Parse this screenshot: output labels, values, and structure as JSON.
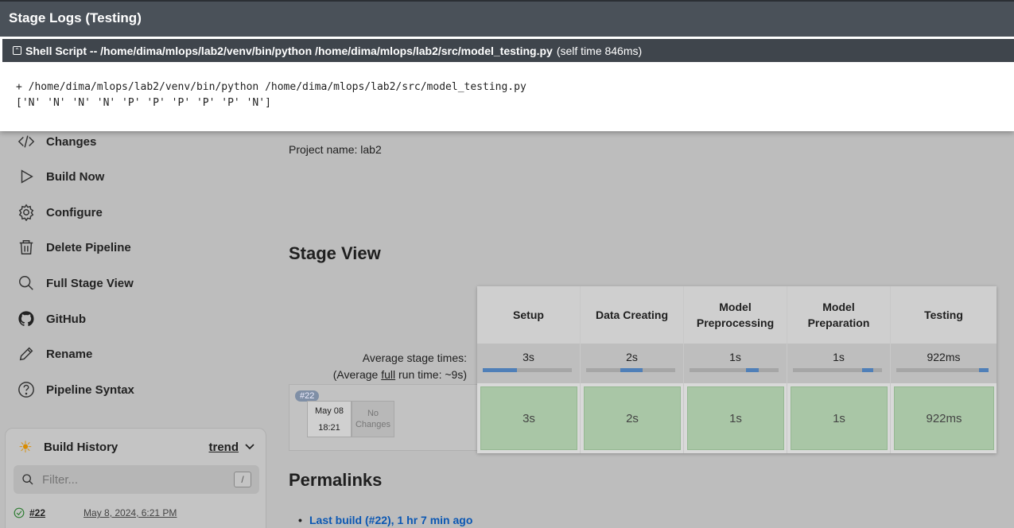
{
  "modal": {
    "title": "Stage Logs (Testing)",
    "step_header_cmd": "Shell Script -- /home/dima/mlops/lab2/venv/bin/python /home/dima/mlops/lab2/src/model_testing.py",
    "step_header_time": "(self time 846ms)",
    "log_lines": [
      "+ /home/dima/mlops/lab2/venv/bin/python /home/dima/mlops/lab2/src/model_testing.py",
      "['N' 'N' 'N' 'N' 'P' 'P' 'P' 'P' 'P' 'N']"
    ]
  },
  "sidebar": {
    "items": [
      {
        "label": "Changes",
        "icon": "code-icon"
      },
      {
        "label": "Build Now",
        "icon": "play-icon"
      },
      {
        "label": "Configure",
        "icon": "gear-icon"
      },
      {
        "label": "Delete Pipeline",
        "icon": "trash-icon"
      },
      {
        "label": "Full Stage View",
        "icon": "search-icon"
      },
      {
        "label": "GitHub",
        "icon": "github-icon"
      },
      {
        "label": "Rename",
        "icon": "pencil-icon"
      },
      {
        "label": "Pipeline Syntax",
        "icon": "help-icon"
      }
    ]
  },
  "history": {
    "title": "Build History",
    "trend": "trend",
    "filter_placeholder": "Filter...",
    "filter_shortcut": "/",
    "build": {
      "number": "#22",
      "date": "May 8, 2024, 6:21 PM"
    }
  },
  "main": {
    "project_name": "Project name: lab2",
    "stage_view_title": "Stage View",
    "avg_stage_times": "Average stage times:",
    "avg_full_prefix": "(Average ",
    "avg_full_word": "full",
    "avg_full_suffix": " run time: ~9s)",
    "permalinks_title": "Permalinks",
    "permalink_last": "Last build (#22), 1 hr 7 min ago"
  },
  "build_row": {
    "badge": "#22",
    "date": "May 08",
    "time": "18:21",
    "changes_line1": "No",
    "changes_line2": "Changes"
  },
  "stages": [
    {
      "name_line1": "Setup",
      "name_line2": "",
      "avg": "3s",
      "duration": "3s",
      "bar_start": 0.0,
      "bar_fraction": 0.38
    },
    {
      "name_line1": "Data Creating",
      "name_line2": "",
      "avg": "2s",
      "duration": "2s",
      "bar_start": 0.38,
      "bar_fraction": 0.25
    },
    {
      "name_line1": "Model",
      "name_line2": "Preprocessing",
      "avg": "1s",
      "duration": "1s",
      "bar_start": 0.63,
      "bar_fraction": 0.15
    },
    {
      "name_line1": "Model",
      "name_line2": "Preparation",
      "avg": "1s",
      "duration": "1s",
      "bar_start": 0.78,
      "bar_fraction": 0.12
    },
    {
      "name_line1": "Testing",
      "name_line2": "",
      "avg": "922ms",
      "duration": "922ms",
      "bar_start": 0.9,
      "bar_fraction": 0.1
    }
  ]
}
